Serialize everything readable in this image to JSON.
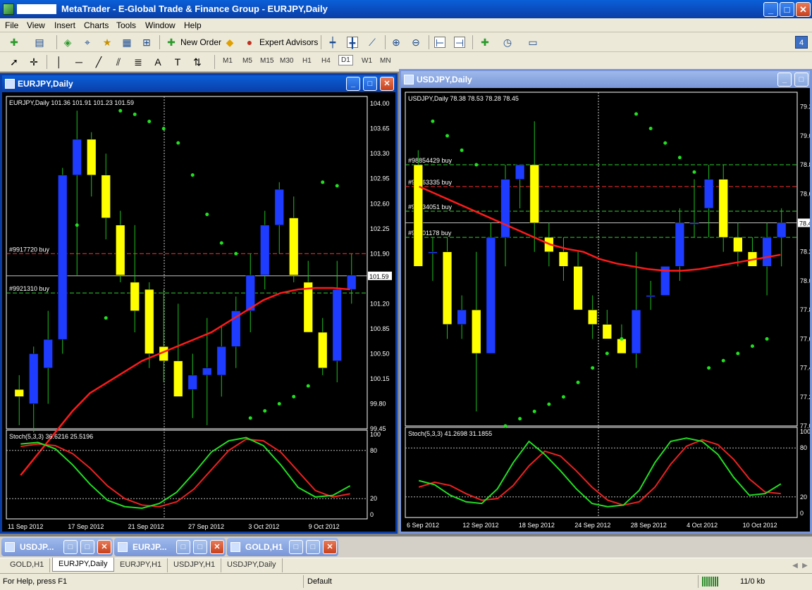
{
  "app": {
    "title": "MetaTrader - E-Global Trade & Finance Group - EURJPY,Daily",
    "win_buttons": {
      "minimize": "_",
      "maximize": "□",
      "close": "✕"
    }
  },
  "menu": [
    "File",
    "View",
    "Insert",
    "Charts",
    "Tools",
    "Window",
    "Help"
  ],
  "toolbar": {
    "new_order": "New Order",
    "expert_advisors": "Expert Advisors",
    "badge": "4",
    "timeframes": [
      "M1",
      "M5",
      "M15",
      "M30",
      "H1",
      "H4",
      "D1",
      "W1",
      "MN"
    ],
    "selected_timeframe": "D1"
  },
  "charts": [
    {
      "window_title": "EURJPY,Daily",
      "info": "EURJPY,Daily  101.36 101.91 101.23 101.59",
      "price_labels": [
        "104.00",
        "103.65",
        "103.30",
        "102.95",
        "102.60",
        "102.25",
        "101.90",
        "101.59",
        "101.20",
        "100.85",
        "100.50",
        "100.15",
        "99.80",
        "99.45"
      ],
      "current_price": "101.59",
      "ylim": [
        99.45,
        104.1
      ],
      "candles": [
        [
          100.0,
          100.2,
          99.5,
          99.9
        ],
        [
          99.8,
          100.6,
          99.4,
          100.5
        ],
        [
          100.3,
          101.1,
          99.8,
          100.7
        ],
        [
          100.7,
          103.1,
          100.5,
          103.0
        ],
        [
          103.0,
          103.9,
          101.6,
          103.5
        ],
        [
          103.5,
          103.6,
          102.7,
          103.0
        ],
        [
          103.0,
          103.3,
          102.1,
          102.4
        ],
        [
          102.3,
          102.5,
          101.5,
          101.6
        ],
        [
          101.5,
          102.3,
          100.8,
          101.1
        ],
        [
          101.4,
          101.5,
          100.3,
          100.5
        ],
        [
          100.6,
          101.4,
          100.1,
          100.4
        ],
        [
          100.4,
          101.2,
          99.9,
          99.9
        ],
        [
          100.0,
          100.5,
          99.6,
          100.2
        ],
        [
          100.2,
          101.0,
          99.5,
          100.3
        ],
        [
          100.2,
          100.9,
          99.9,
          100.6
        ],
        [
          100.6,
          101.3,
          100.3,
          101.1
        ],
        [
          101.1,
          101.9,
          100.8,
          101.6
        ],
        [
          101.6,
          102.5,
          101.4,
          102.3
        ],
        [
          102.3,
          102.9,
          101.9,
          102.8
        ],
        [
          102.4,
          102.7,
          101.5,
          101.6
        ],
        [
          101.5,
          101.8,
          100.8,
          100.8
        ],
        [
          100.8,
          101.0,
          100.2,
          100.3
        ],
        [
          100.4,
          101.8,
          100.1,
          101.4
        ],
        [
          101.4,
          101.9,
          101.2,
          101.6
        ]
      ],
      "ma": [
        98.8,
        99.1,
        99.4,
        99.7,
        99.95,
        100.1,
        100.25,
        100.4,
        100.5,
        100.6,
        100.7,
        100.8,
        100.95,
        101.1,
        101.25,
        101.35,
        101.4,
        101.42,
        101.42,
        101.4
      ],
      "sar": [
        [
          4,
          102.3
        ],
        [
          6,
          101.0
        ],
        [
          7,
          103.9
        ],
        [
          8,
          103.85
        ],
        [
          9,
          103.75
        ],
        [
          10,
          103.65
        ],
        [
          11,
          103.45
        ],
        [
          12,
          103.0
        ],
        [
          13,
          102.45
        ],
        [
          14,
          102.05
        ],
        [
          15,
          101.9
        ],
        [
          16,
          99.6
        ],
        [
          17,
          99.7
        ],
        [
          18,
          99.8
        ],
        [
          19,
          99.9
        ],
        [
          20,
          100.05
        ],
        [
          21,
          102.9
        ],
        [
          22,
          102.85
        ]
      ],
      "order_lines": [
        {
          "label": "#9917720 buy",
          "price": 101.9,
          "color": "#ff3030"
        },
        {
          "label": "#9921310 buy",
          "price": 101.35,
          "color": "#30d030"
        }
      ],
      "stoch_label": "Stoch(5,3,3) 36.6216 25.5196",
      "stoch_levels": [
        "100",
        "80",
        "20",
        "0"
      ],
      "stoch_k": [
        88,
        90,
        82,
        62,
        38,
        18,
        10,
        8,
        14,
        28,
        52,
        78,
        92,
        96,
        86,
        62,
        34,
        22,
        24,
        36
      ],
      "stoch_d": [
        85,
        88,
        86,
        76,
        58,
        36,
        20,
        12,
        10,
        16,
        32,
        56,
        80,
        94,
        92,
        78,
        54,
        30,
        22,
        26
      ],
      "date_labels": [
        "11 Sep 2012",
        "17 Sep 2012",
        "21 Sep 2012",
        "27 Sep 2012",
        "3 Oct 2012",
        "9 Oct 2012"
      ]
    },
    {
      "window_title": "USDJPY,Daily",
      "info": "USDJPY,Daily  78.38 78.53 78.28 78.45",
      "price_labels": [
        "79.2",
        "79.0",
        "78.8",
        "78.6",
        "78.4",
        "78.2",
        "78.0",
        "77.8",
        "77.6",
        "77.4",
        "77.2",
        "77.0"
      ],
      "current_price": "78.4",
      "ylim": [
        77.0,
        79.3
      ],
      "candles": [
        [
          78.8,
          78.9,
          78.2,
          78.1
        ],
        [
          78.2,
          78.3,
          78.0,
          78.2
        ],
        [
          78.2,
          78.3,
          77.6,
          77.7
        ],
        [
          77.7,
          77.9,
          77.6,
          77.8
        ],
        [
          77.8,
          78.2,
          77.1,
          77.5
        ],
        [
          77.5,
          78.4,
          77.5,
          78.3
        ],
        [
          78.3,
          78.8,
          78.1,
          78.7
        ],
        [
          78.7,
          78.8,
          78.5,
          78.8
        ],
        [
          78.8,
          79.1,
          78.2,
          78.4
        ],
        [
          78.3,
          78.4,
          78.1,
          78.2
        ],
        [
          78.2,
          78.3,
          78.0,
          78.1
        ],
        [
          78.1,
          78.2,
          77.8,
          77.8
        ],
        [
          77.8,
          77.9,
          77.6,
          77.7
        ],
        [
          77.7,
          77.8,
          77.6,
          77.6
        ],
        [
          77.6,
          77.7,
          77.5,
          77.5
        ],
        [
          77.5,
          78.2,
          77.4,
          77.8
        ],
        [
          77.9,
          78.0,
          77.8,
          77.9
        ],
        [
          77.9,
          78.1,
          77.9,
          78.1
        ],
        [
          78.1,
          78.5,
          78.0,
          78.4
        ],
        [
          78.4,
          78.7,
          78.3,
          78.4
        ],
        [
          78.5,
          78.8,
          78.3,
          78.7
        ],
        [
          78.7,
          78.8,
          78.2,
          78.3
        ],
        [
          78.3,
          78.4,
          78.1,
          78.2
        ],
        [
          78.2,
          78.3,
          78.1,
          78.1
        ],
        [
          78.1,
          78.4,
          77.9,
          78.3
        ],
        [
          78.3,
          78.5,
          78.1,
          78.4
        ]
      ],
      "ma": [
        78.65,
        78.6,
        78.55,
        78.5,
        78.45,
        78.4,
        78.35,
        78.3,
        78.25,
        78.22,
        78.2,
        78.15,
        78.12,
        78.1,
        78.08,
        78.07,
        78.07,
        78.08,
        78.1,
        78.12,
        78.14,
        78.16,
        78.18
      ],
      "sar": [
        [
          1,
          79.1
        ],
        [
          2,
          79.0
        ],
        [
          3,
          78.9
        ],
        [
          4,
          78.8
        ],
        [
          6,
          77.0
        ],
        [
          7,
          77.05
        ],
        [
          8,
          77.1
        ],
        [
          9,
          77.15
        ],
        [
          10,
          77.2
        ],
        [
          11,
          77.3
        ],
        [
          12,
          77.4
        ],
        [
          13,
          77.5
        ],
        [
          14,
          77.6
        ],
        [
          15,
          79.15
        ],
        [
          16,
          79.05
        ],
        [
          17,
          78.95
        ],
        [
          18,
          78.85
        ],
        [
          19,
          78.75
        ],
        [
          20,
          77.4
        ],
        [
          21,
          77.45
        ],
        [
          22,
          77.5
        ],
        [
          23,
          77.55
        ],
        [
          24,
          77.6
        ]
      ],
      "order_lines": [
        {
          "label": "#98854429 buy",
          "price": 78.8,
          "color": "#30d030"
        },
        {
          "label": "#98863335 buy",
          "price": 78.65,
          "color": "#ff3030"
        },
        {
          "label": "#99134051 buy",
          "price": 78.48,
          "color": "#30d030"
        },
        {
          "label": "#99201178 buy",
          "price": 78.3,
          "color": "#30d030"
        }
      ],
      "stoch_label": "Stoch(5,3,3) 41.2698 31.1855",
      "stoch_levels": [
        "100",
        "80",
        "20",
        "0"
      ],
      "stoch_k": [
        40,
        35,
        22,
        14,
        12,
        30,
        62,
        88,
        72,
        52,
        30,
        12,
        8,
        10,
        28,
        62,
        88,
        92,
        88,
        72,
        44,
        22,
        24,
        36
      ],
      "stoch_d": [
        32,
        38,
        34,
        24,
        16,
        18,
        34,
        58,
        76,
        70,
        52,
        32,
        16,
        10,
        14,
        32,
        60,
        82,
        90,
        84,
        66,
        42,
        26,
        24
      ],
      "date_labels": [
        "6 Sep 2012",
        "12 Sep 2012",
        "18 Sep 2012",
        "24 Sep 2012",
        "28 Sep 2012",
        "4 Oct 2012",
        "10 Oct 2012"
      ]
    }
  ],
  "taskbar_windows": [
    {
      "label": "USDJP..."
    },
    {
      "label": "EURJP..."
    },
    {
      "label": "GOLD,H1"
    }
  ],
  "tabs": [
    "GOLD,H1",
    "EURJPY,Daily",
    "EURJPY,H1",
    "USDJPY,H1",
    "USDJPY,Daily"
  ],
  "active_tab": "EURJPY,Daily",
  "status": {
    "help": "For Help, press F1",
    "profile": "Default",
    "traffic": "11/0 kb"
  },
  "colors": {
    "bull": "#1e3cff",
    "bear": "#ffff00",
    "ma": "#ff1a1a",
    "sar": "#20e020",
    "stoch_k": "#22dd22",
    "stoch_d": "#ee2020",
    "wick": "#20c020"
  }
}
